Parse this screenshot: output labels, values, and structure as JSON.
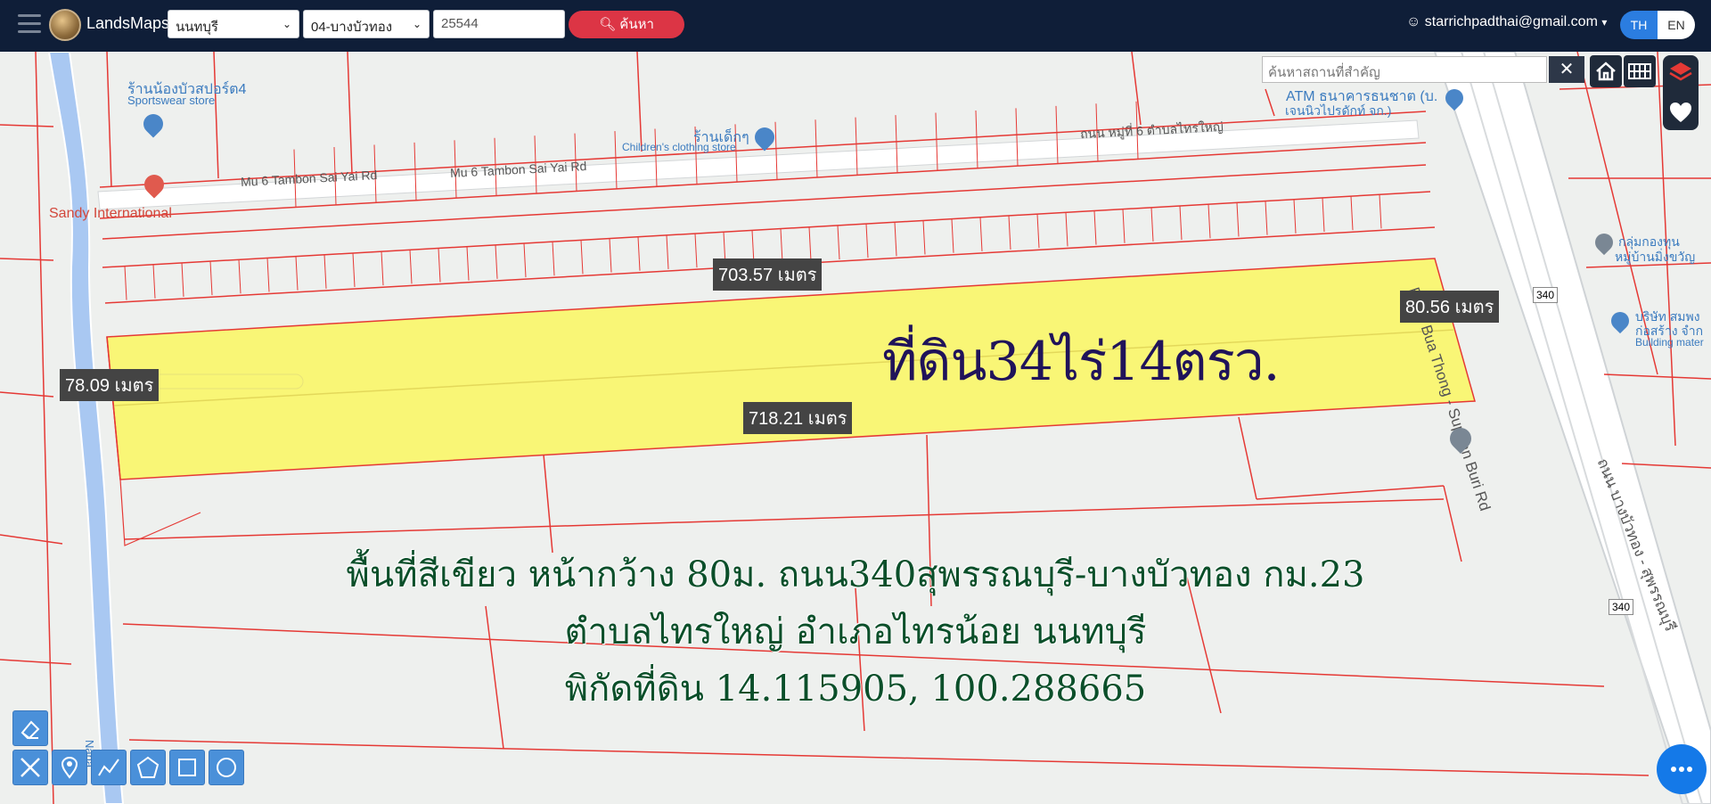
{
  "header": {
    "brand": "LandsMaps",
    "province": "นนทบุรี",
    "district": "04-บางบัวทอง",
    "parcel_number": "25544",
    "search_label": "ค้นหา",
    "user_email": "starrichpadthai@gmail.com",
    "lang_th": "TH",
    "lang_en": "EN"
  },
  "map_search": {
    "placeholder": "ค้นหาสถานที่สำคัญ"
  },
  "map_labels": {
    "store1": "ร้านน้องบัวสปอร์ต4",
    "store1_sub": "Sportswear store",
    "store2": "ร้านเด็กๆ",
    "store2_sub": "Children's clothing store",
    "sandy": "Sandy International",
    "road1": "Mu 6 Tambon Sai Yai Rd",
    "road2": "Mu 6 Tambon Sai Yai Rd",
    "road_th": "ถนน หมู่ที่ 6 ตำบลไทรใหญ่",
    "atm": "ATM ธนาคารธนชาต (บ.",
    "atm2": "เจนนิวไปรดักท์ จก.)",
    "main_road": "Bang Bua Thong - Suphan Buri Rd",
    "main_road_th": "ถนน บางบัวทอง - สุพรรณบุรี",
    "route_number_1": "340",
    "route_number_2": "340",
    "group_name": "กลุ่มกองทุน",
    "group_name2": "หมู่บ้านมิ่งขวัญ",
    "company": "บริษัท สมพง",
    "company2": "ก่อสร้าง จำก",
    "company3": "Building mater",
    "canal": "Nana"
  },
  "measurements": {
    "top": "703.57 เมตร",
    "right": "80.56 เมตร",
    "left": "78.09 เมตร",
    "bottom": "718.21 เมตร"
  },
  "overlay": {
    "title": "ที่ดิน34ไร่14ตรว.",
    "line1": "พื้นที่สีเขียว หน้ากว้าง 80ม. ถนน340สุพรรณบุรี-บางบัวทอง กม.23",
    "line2": "ตำบลไทรใหญ่ อำเภอไทรน้อย นนทบุรี",
    "line3": "พิกัดที่ดิน 14.115905, 100.288665"
  },
  "colors": {
    "topbar": "#0f1e38",
    "search_button": "#dc3545",
    "parcel_fill": "#f9f66f",
    "parcel_line": "#e53935",
    "canal": "#a9c8f2"
  }
}
